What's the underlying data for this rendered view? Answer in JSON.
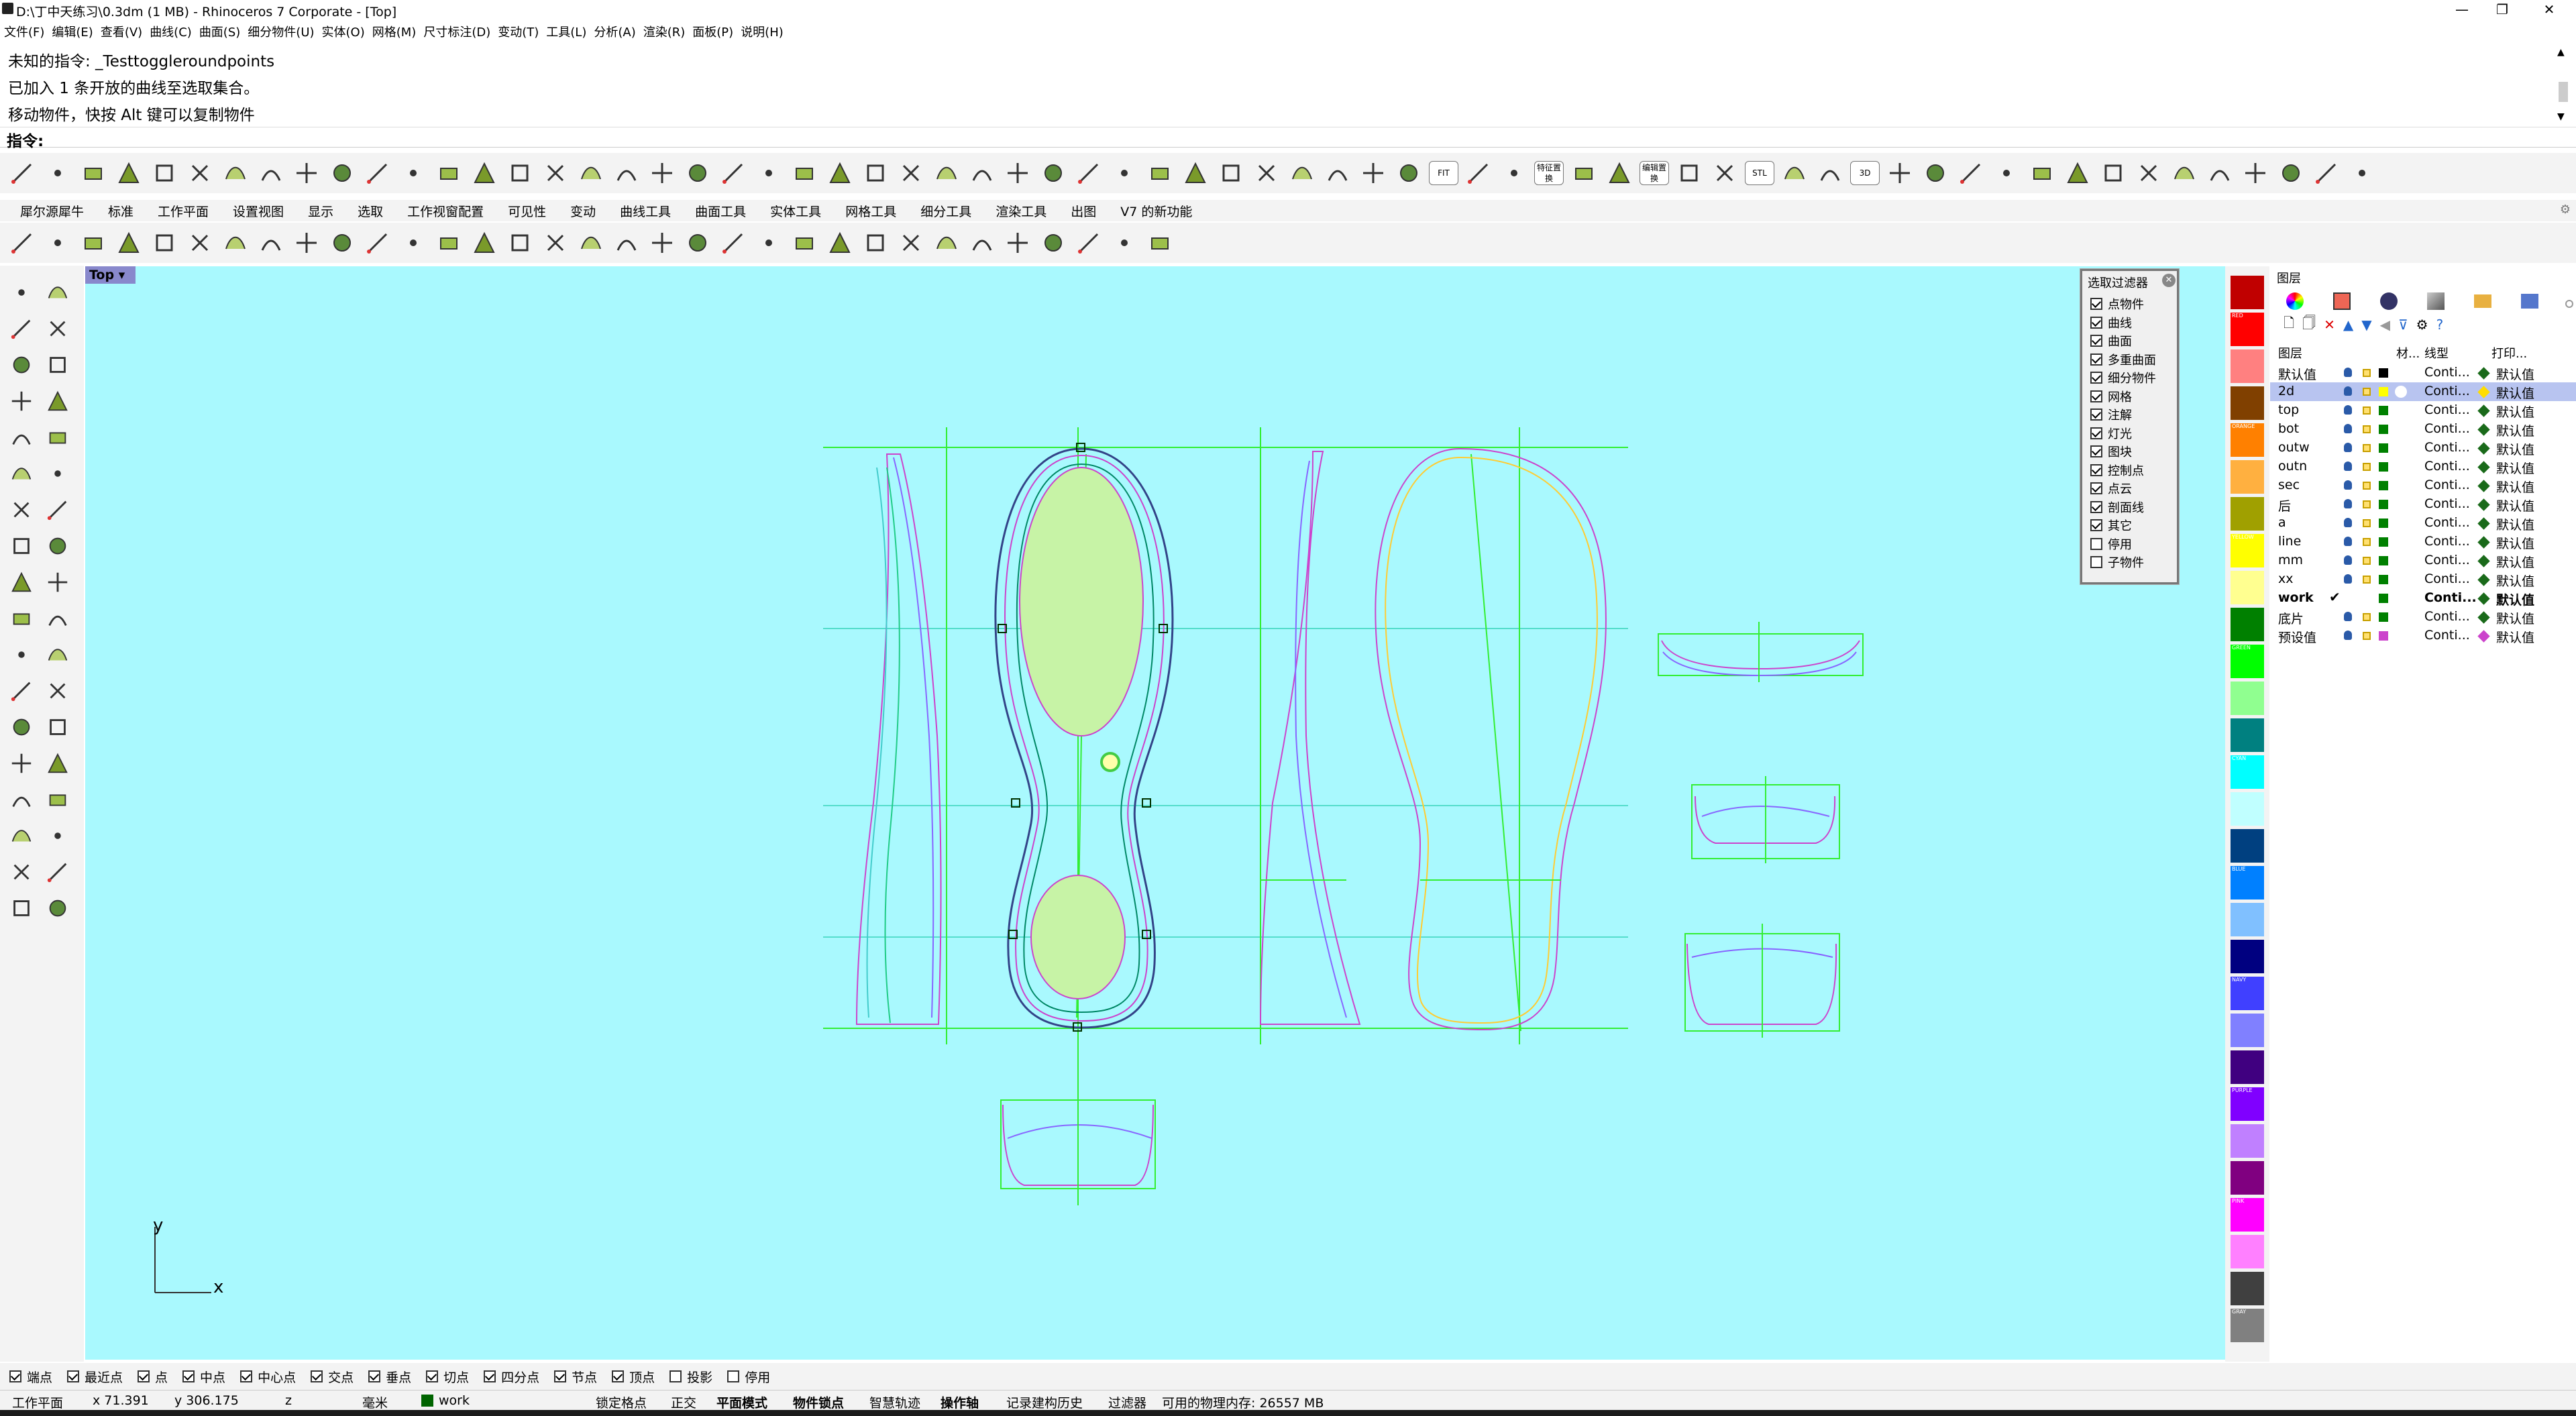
{
  "window": {
    "title": "D:\\丁中天练习\\0.3dm (1 MB) - Rhinoceros 7 Corporate - [Top]"
  },
  "menu": [
    "文件(F)",
    "编辑(E)",
    "查看(V)",
    "曲线(C)",
    "曲面(S)",
    "细分物件(U)",
    "实体(O)",
    "网格(M)",
    "尺寸标注(D)",
    "变动(T)",
    "工具(L)",
    "分析(A)",
    "渲染(R)",
    "面板(P)",
    "说明(H)"
  ],
  "command_history": [
    "未知的指令: _Testtoggleroundpoints",
    "已加入 1 条开放的曲线至选取集合。",
    "移动物件，快按 Alt 键可以复制物件"
  ],
  "command_prompt": "指令:",
  "tabs": [
    "犀尔源犀牛",
    "标准",
    "工作平面",
    "设置视图",
    "显示",
    "选取",
    "工作视窗配置",
    "可见性",
    "变动",
    "曲线工具",
    "曲面工具",
    "实体工具",
    "网格工具",
    "细分工具",
    "渲染工具",
    "出图",
    "V7 的新功能"
  ],
  "toolbar_text_buttons": [
    "FIT",
    "特征置换",
    "编辑置换",
    "STL",
    "3D"
  ],
  "viewport": {
    "label": "Top",
    "axis_x": "x",
    "axis_y": "y",
    "bg_color": "#a9f9fe"
  },
  "select_filter": {
    "title": "选取过滤器",
    "items": [
      {
        "label": "点物件",
        "checked": true
      },
      {
        "label": "曲线",
        "checked": true
      },
      {
        "label": "曲面",
        "checked": true
      },
      {
        "label": "多重曲面",
        "checked": true
      },
      {
        "label": "细分物件",
        "checked": true
      },
      {
        "label": "网格",
        "checked": true
      },
      {
        "label": "注解",
        "checked": true
      },
      {
        "label": "灯光",
        "checked": true
      },
      {
        "label": "图块",
        "checked": true
      },
      {
        "label": "控制点",
        "checked": true
      },
      {
        "label": "点云",
        "checked": true
      },
      {
        "label": "剖面线",
        "checked": true
      },
      {
        "label": "其它",
        "checked": true
      },
      {
        "label": "停用",
        "checked": false
      },
      {
        "label": "子物件",
        "checked": false
      }
    ]
  },
  "swatches": [
    {
      "color": "#c00000",
      "label": ""
    },
    {
      "color": "#ff0000",
      "label": "RED"
    },
    {
      "color": "#ff8080",
      "label": ""
    },
    {
      "color": "#804000",
      "label": ""
    },
    {
      "color": "#ff8000",
      "label": "ORANGE"
    },
    {
      "color": "#ffb040",
      "label": ""
    },
    {
      "color": "#a0a000",
      "label": ""
    },
    {
      "color": "#ffff00",
      "label": "YELLOW"
    },
    {
      "color": "#ffff90",
      "label": ""
    },
    {
      "color": "#008000",
      "label": ""
    },
    {
      "color": "#00ff00",
      "label": "GREEN"
    },
    {
      "color": "#90ff90",
      "label": ""
    },
    {
      "color": "#008080",
      "label": ""
    },
    {
      "color": "#00ffff",
      "label": "CYAN"
    },
    {
      "color": "#c0ffff",
      "label": ""
    },
    {
      "color": "#004080",
      "label": ""
    },
    {
      "color": "#0080ff",
      "label": "BLUE"
    },
    {
      "color": "#80c0ff",
      "label": ""
    },
    {
      "color": "#000080",
      "label": ""
    },
    {
      "color": "#4040ff",
      "label": "NAVY"
    },
    {
      "color": "#8080ff",
      "label": ""
    },
    {
      "color": "#400080",
      "label": ""
    },
    {
      "color": "#8000ff",
      "label": "PURPLE"
    },
    {
      "color": "#c080ff",
      "label": ""
    },
    {
      "color": "#800080",
      "label": ""
    },
    {
      "color": "#ff00ff",
      "label": "PINK"
    },
    {
      "color": "#ff80ff",
      "label": ""
    },
    {
      "color": "#404040",
      "label": ""
    },
    {
      "color": "#808080",
      "label": "GRAY"
    }
  ],
  "layers": {
    "panel_title": "图层",
    "col_layer": "图层",
    "col_material": "材...",
    "col_linetype": "线型",
    "col_print": "打印...",
    "rows": [
      {
        "name": "默认值",
        "color": "#000000",
        "linetype": "Conti...",
        "print": "默认值",
        "selected": false,
        "current": false
      },
      {
        "name": "2d",
        "color": "#ffff00",
        "linetype": "Conti...",
        "print": "默认值",
        "selected": true,
        "current": false
      },
      {
        "name": "top",
        "color": "#008000",
        "linetype": "Conti...",
        "print": "默认值",
        "selected": false,
        "current": false
      },
      {
        "name": "bot",
        "color": "#008000",
        "linetype": "Conti...",
        "print": "默认值",
        "selected": false,
        "current": false
      },
      {
        "name": "outw",
        "color": "#008000",
        "linetype": "Conti...",
        "print": "默认值",
        "selected": false,
        "current": false
      },
      {
        "name": "outn",
        "color": "#008000",
        "linetype": "Conti...",
        "print": "默认值",
        "selected": false,
        "current": false
      },
      {
        "name": "sec",
        "color": "#008000",
        "linetype": "Conti...",
        "print": "默认值",
        "selected": false,
        "current": false
      },
      {
        "name": "后",
        "color": "#008000",
        "linetype": "Conti...",
        "print": "默认值",
        "selected": false,
        "current": false
      },
      {
        "name": "a",
        "color": "#008000",
        "linetype": "Conti...",
        "print": "默认值",
        "selected": false,
        "current": false
      },
      {
        "name": "line",
        "color": "#008000",
        "linetype": "Conti...",
        "print": "默认值",
        "selected": false,
        "current": false
      },
      {
        "name": "mm",
        "color": "#008000",
        "linetype": "Conti...",
        "print": "默认值",
        "selected": false,
        "current": false
      },
      {
        "name": "xx",
        "color": "#008000",
        "linetype": "Conti...",
        "print": "默认值",
        "selected": false,
        "current": false
      },
      {
        "name": "work",
        "color": "#008000",
        "linetype": "Conti...",
        "print": "默认值",
        "selected": false,
        "current": true
      },
      {
        "name": "底片",
        "color": "#008000",
        "linetype": "Conti...",
        "print": "默认值",
        "selected": false,
        "current": false
      },
      {
        "name": "预设值",
        "color": "#cc44cc",
        "linetype": "Conti...",
        "print": "默认值",
        "selected": false,
        "current": false
      }
    ]
  },
  "osnap": [
    {
      "label": "端点",
      "checked": true
    },
    {
      "label": "最近点",
      "checked": true
    },
    {
      "label": "点",
      "checked": true
    },
    {
      "label": "中点",
      "checked": true
    },
    {
      "label": "中心点",
      "checked": true
    },
    {
      "label": "交点",
      "checked": true
    },
    {
      "label": "垂点",
      "checked": true
    },
    {
      "label": "切点",
      "checked": true
    },
    {
      "label": "四分点",
      "checked": true
    },
    {
      "label": "节点",
      "checked": true
    },
    {
      "label": "顶点",
      "checked": true
    },
    {
      "label": "投影",
      "checked": false
    },
    {
      "label": "停用",
      "checked": false
    }
  ],
  "status": {
    "cplane": "工作平面",
    "x": "x 71.391",
    "y": "y 306.175",
    "z": "z",
    "units": "毫米",
    "layer": "work",
    "layer_color": "#006400",
    "lock_grid": "锁定格点",
    "ortho": "正交",
    "planar": "平面模式",
    "osnap": "物件锁点",
    "smarttrack": "智慧轨迹",
    "gumball": "操作轴",
    "history": "记录建构历史",
    "filter": "过滤器",
    "memory": "可用的物理内存: 26557 MB"
  }
}
